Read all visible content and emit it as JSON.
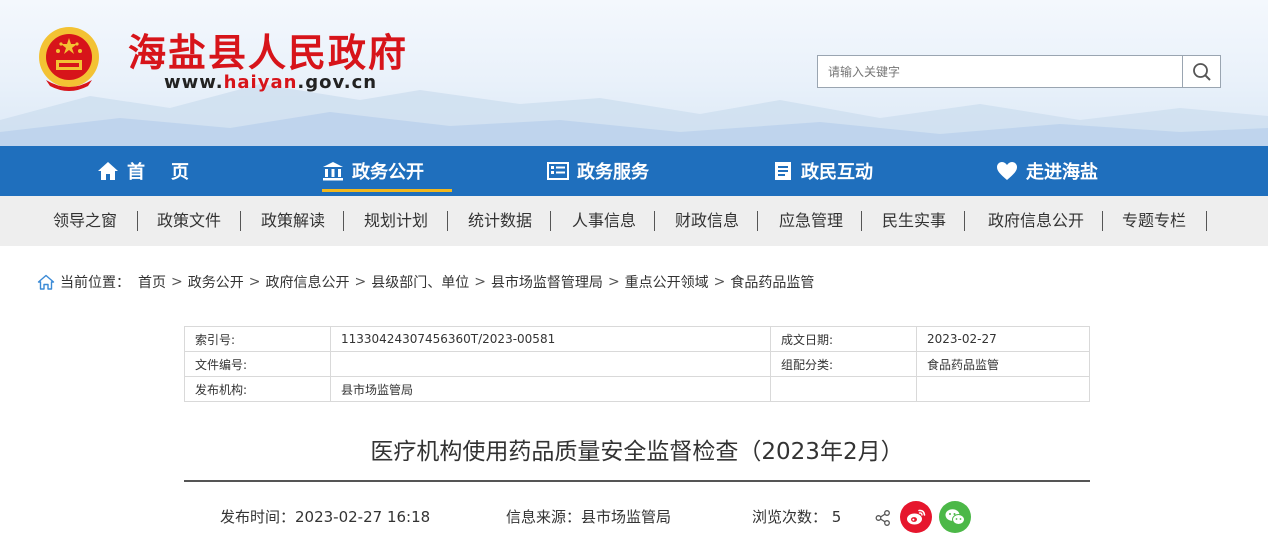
{
  "header": {
    "site_title": "海盐县人民政府",
    "site_url_prefix": "www.",
    "site_url_highlight": "haiyan",
    "site_url_suffix": ".gov.cn",
    "search_placeholder": "请输入关键字"
  },
  "main_nav": [
    {
      "label": "首　页",
      "icon": "home-icon"
    },
    {
      "label": "政务公开",
      "icon": "government-building-icon",
      "active": true
    },
    {
      "label": "政务服务",
      "icon": "list-icon"
    },
    {
      "label": "政民互动",
      "icon": "document-icon"
    },
    {
      "label": "走进海盐",
      "icon": "heart-icon"
    }
  ],
  "sub_nav": [
    "领导之窗",
    "政策文件",
    "政策解读",
    "规划计划",
    "统计数据",
    "人事信息",
    "财政信息",
    "应急管理",
    "民生实事",
    "政府信息公开",
    "专题专栏"
  ],
  "breadcrumb": {
    "label": "当前位置：",
    "items": [
      "首页",
      "政务公开",
      "政府信息公开",
      "县级部门、单位",
      "县市场监督管理局",
      "重点公开领域",
      "食品药品监管"
    ],
    "separator": ">"
  },
  "info_table": {
    "index_label": "索引号:",
    "index_value": "11330424307456360T/2023-00581",
    "date_label": "成文日期:",
    "date_value": "2023-02-27",
    "docno_label": "文件编号:",
    "docno_value": "",
    "category_label": "组配分类:",
    "category_value": "食品药品监管",
    "publisher_label": "发布机构:",
    "publisher_value": "县市场监管局"
  },
  "article": {
    "title": "医疗机构使用药品质量安全监督检查（2023年2月）",
    "publish_time": "发布时间：2023-02-27 16:18",
    "source": "信息来源：县市场监管局",
    "views": "浏览次数：  5"
  },
  "colors": {
    "brand_red": "#d7141a",
    "nav_blue": "#1f6fbd",
    "active_underline": "#f2b71d",
    "weibo_red": "#e6162d",
    "wechat_green": "#4cb848"
  }
}
